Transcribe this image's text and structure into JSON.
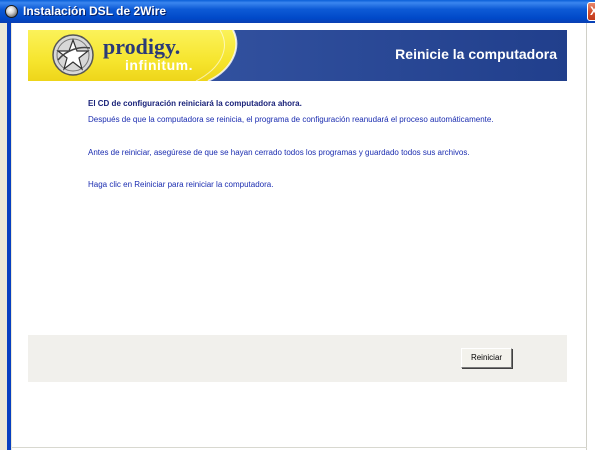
{
  "window": {
    "title": "Instalación DSL de 2Wire",
    "icon": "setup-disc-icon",
    "close_glyph": "X"
  },
  "banner": {
    "brand_primary": "prodigy.",
    "brand_secondary": "infinitum.",
    "logo": "prodigy-star-logo",
    "title": "Reinicie la computadora"
  },
  "content": {
    "heading": "El CD de configuración reiniciará la computadora ahora.",
    "paragraphs": [
      "Después de que la computadora se reinicia, el programa de configuración reanudará el proceso automáticamente.",
      "Antes de reiniciar, asegúrese de que se hayan cerrado todos los programas y guardado todos sus archivos.",
      "Haga clic en Reiniciar para reiniciar la computadora."
    ]
  },
  "footer": {
    "restart_label": "Reiniciar"
  },
  "colors": {
    "titlebar": "#0a57d3",
    "banner_yellow": "#f7e93a",
    "banner_blue": "#2a4a95",
    "text_blue": "#1a2cb0",
    "heading_navy": "#1a237a"
  }
}
